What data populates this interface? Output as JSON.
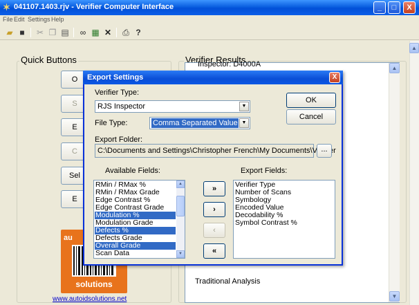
{
  "window": {
    "title": "041107.1403.rjv - Verifier Computer Interface",
    "minimize": "_",
    "maximize": "□",
    "close": "X"
  },
  "menu": [
    "File",
    "Edit",
    "Settings",
    "Help"
  ],
  "toolbar": {
    "icons": [
      "open-folder-icon",
      "save-icon",
      "cut-icon",
      "copy-icon",
      "paste-icon",
      "binoculars-icon",
      "spreadsheet-icon",
      "delete-icon",
      "print-icon",
      "help-icon"
    ]
  },
  "quick_buttons": {
    "title": "Quick Buttons",
    "buttons": [
      {
        "label": "O",
        "enabled": true
      },
      {
        "label": "S",
        "enabled": false
      },
      {
        "label": "E",
        "enabled": true
      },
      {
        "label": "C",
        "enabled": false
      },
      {
        "label": "Sel",
        "enabled": true
      },
      {
        "label": "E",
        "enabled": true
      }
    ]
  },
  "logo": {
    "top_text": "au",
    "bottom_text": "solutions",
    "link": "www.autoidsolutions.net"
  },
  "verifier_results": {
    "title": "Verifier Results",
    "top_line": "Inspector: D4000A",
    "bottom_line": "Traditional Analysis"
  },
  "dialog": {
    "title": "Export Settings",
    "close": "X",
    "verifier_type_label": "Verifier Type:",
    "verifier_type_value": "RJS Inspector",
    "file_type_label": "File Type:",
    "file_type_value": "Comma Separated Value (.CSV)",
    "export_folder_label": "Export Folder:",
    "export_folder_value": "C:\\Documents and Settings\\Christopher French\\My Documents\\Verifier",
    "browse_label": "...",
    "ok_label": "OK",
    "cancel_label": "Cancel",
    "available_fields_label": "Available Fields:",
    "export_fields_label": "Export Fields:",
    "available_fields": [
      {
        "text": "RMin / RMax %",
        "selected": false
      },
      {
        "text": "RMin / RMax Grade",
        "selected": false
      },
      {
        "text": "Edge Contrast %",
        "selected": false
      },
      {
        "text": "Edge Contrast Grade",
        "selected": false
      },
      {
        "text": "Modulation %",
        "selected": true
      },
      {
        "text": "Modulation Grade",
        "selected": false
      },
      {
        "text": "Defects %",
        "selected": true
      },
      {
        "text": "Defects Grade",
        "selected": false
      },
      {
        "text": "Overall Grade",
        "selected": true
      },
      {
        "text": "Scan Data",
        "selected": false
      }
    ],
    "export_fields": [
      "Verifier Type",
      "Number of Scans",
      "Symbology",
      "Encoded Value",
      "Decodability %",
      "Symbol Contrast %"
    ],
    "move_buttons": {
      "add_all": "»",
      "add": "›",
      "remove": "‹",
      "remove_all": "«"
    }
  }
}
